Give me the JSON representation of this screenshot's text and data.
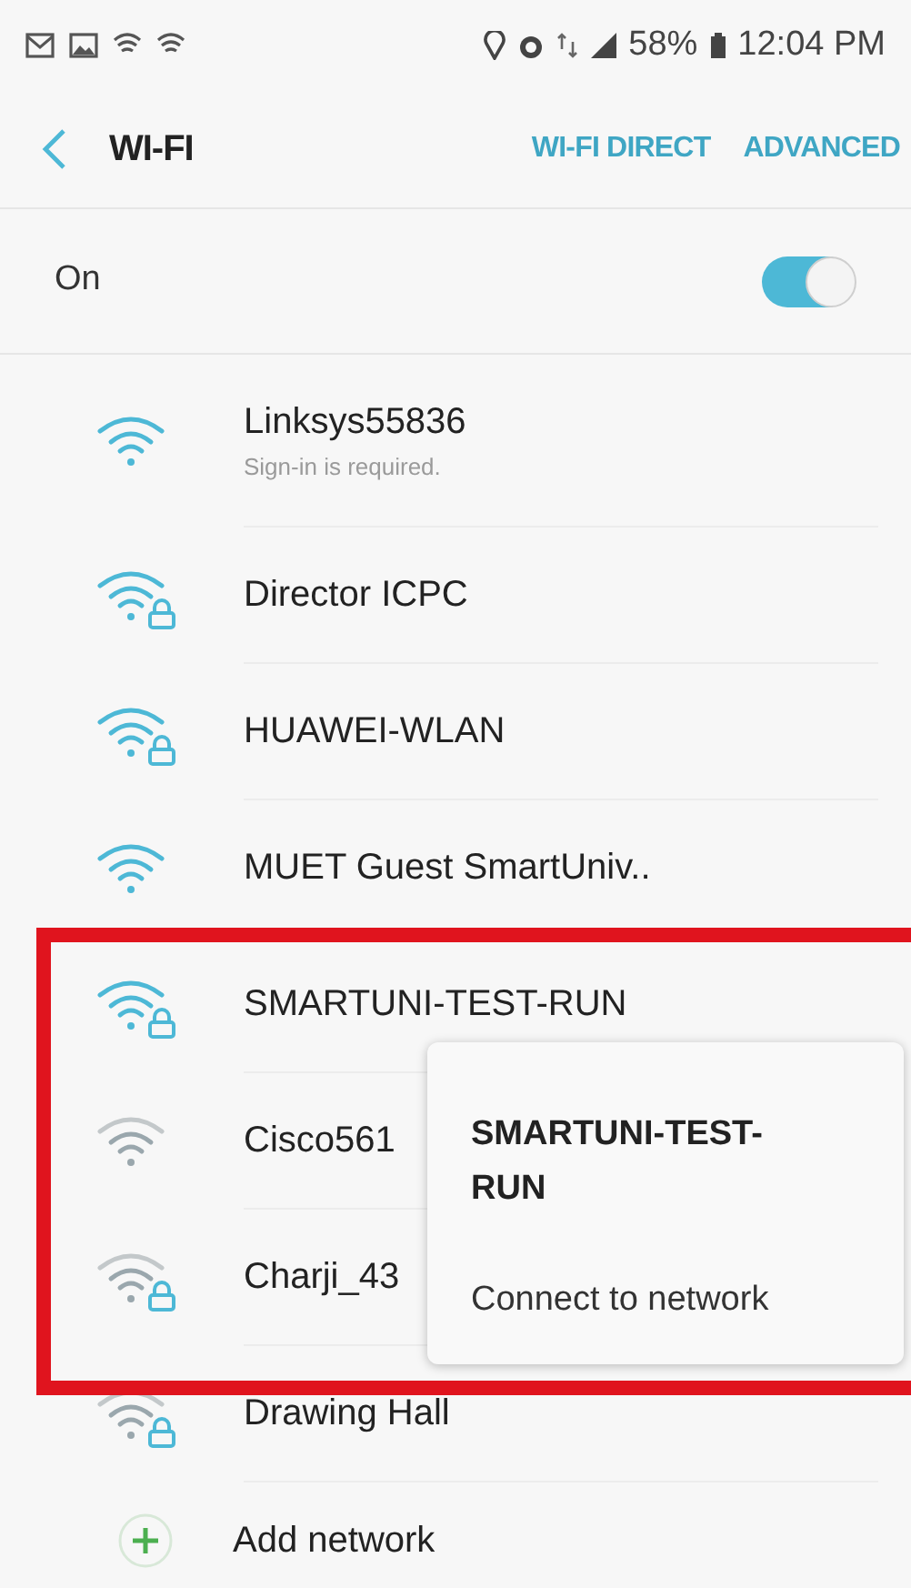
{
  "status_bar": {
    "battery": "58%",
    "time": "12:04 PM"
  },
  "header": {
    "title": "WI-FI",
    "actions": [
      "WI-FI DIRECT",
      "ADVANCED"
    ]
  },
  "master_switch": {
    "label": "On",
    "on": true
  },
  "networks": [
    {
      "name": "Linksys55836",
      "subtitle": "Sign-in is required.",
      "secured": false,
      "weak": false
    },
    {
      "name": "Director ICPC",
      "secured": true,
      "weak": false
    },
    {
      "name": "HUAWEI-WLAN",
      "secured": true,
      "weak": false
    },
    {
      "name": "MUET Guest SmartUniv..",
      "secured": false,
      "weak": false
    },
    {
      "name": "SMARTUNI-TEST-RUN",
      "secured": true,
      "weak": false
    },
    {
      "name": "Cisco561",
      "secured": false,
      "weak": true
    },
    {
      "name": "Charji_43",
      "secured": true,
      "weak": true
    },
    {
      "name": "Drawing Hall",
      "secured": true,
      "weak": true
    }
  ],
  "add_network": {
    "label": "Add network"
  },
  "popup": {
    "title": "SMARTUNI-TEST-RUN",
    "action": "Connect to network"
  }
}
